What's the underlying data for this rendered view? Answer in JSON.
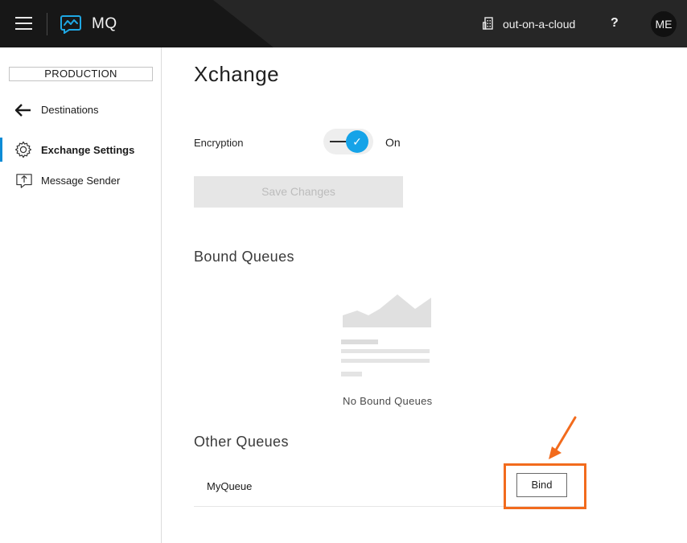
{
  "header": {
    "app_name": "MQ",
    "org_name": "out-on-a-cloud",
    "help_label": "?",
    "avatar_initials": "ME"
  },
  "sidebar": {
    "environment": "PRODUCTION",
    "items": [
      {
        "label": "Destinations",
        "icon": "arrow-left-icon"
      },
      {
        "label": "Exchange Settings",
        "icon": "gear-icon",
        "active": true
      },
      {
        "label": "Message Sender",
        "icon": "message-send-icon"
      }
    ]
  },
  "main": {
    "title": "Xchange",
    "encryption": {
      "label": "Encryption",
      "state": "On",
      "enabled": true
    },
    "save_label": "Save Changes",
    "bound_queues": {
      "title": "Bound Queues",
      "empty_text": "No Bound Queues"
    },
    "other_queues": {
      "title": "Other Queues",
      "rows": [
        {
          "name": "MyQueue",
          "action": "Bind"
        }
      ]
    }
  },
  "colors": {
    "header_bg": "#262626",
    "accent": "#15a3e8",
    "highlight": "#f26b1d"
  }
}
